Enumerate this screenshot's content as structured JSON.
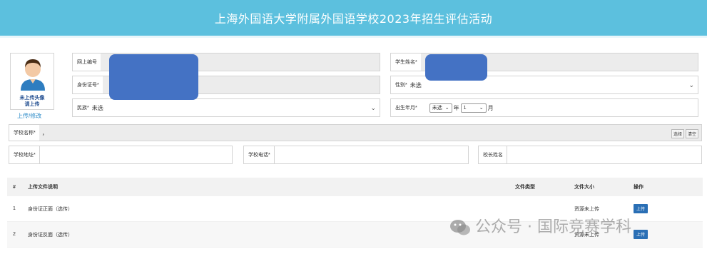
{
  "header": {
    "title": "上海外国语大学附属外国语学校2023年招生评估活动"
  },
  "avatar": {
    "hint_line1": "未上传头像",
    "hint_line2": "请上传",
    "upload_link": "上传/修改"
  },
  "form": {
    "online_id": {
      "label": "网上编号",
      "value": ""
    },
    "id_card": {
      "label": "身份证号",
      "value": ""
    },
    "ethnicity": {
      "label": "民族",
      "value": "未选"
    },
    "student_name": {
      "label": "学生姓名",
      "value": ""
    },
    "gender": {
      "label": "性别",
      "value": "未选"
    },
    "birth": {
      "label": "出生年月",
      "year": "未选",
      "year_unit": "年",
      "month": "1",
      "month_unit": "月"
    },
    "school_name": {
      "label": "学校名称",
      "value": "，",
      "select_btn": "选择",
      "clear_btn": "清空"
    },
    "school_address": {
      "label": "学校地址",
      "value": ""
    },
    "school_phone": {
      "label": "学校电话",
      "value": ""
    },
    "principal_name": {
      "label": "校长姓名",
      "value": ""
    },
    "required_mark": "*"
  },
  "files_table": {
    "headers": {
      "index": "#",
      "desc": "上传文件说明",
      "type": "文件类型",
      "size": "文件大小",
      "action": "操作"
    },
    "rows": [
      {
        "index": "1",
        "desc": "身份证正面（选传）",
        "type": "",
        "size": "资源未上传",
        "action": "上传"
      },
      {
        "index": "2",
        "desc": "身份证反面（选传）",
        "type": "",
        "size": "资源未上传",
        "action": "上传"
      }
    ]
  },
  "watermark": {
    "text": "公众号 · 国际竞赛学科"
  }
}
